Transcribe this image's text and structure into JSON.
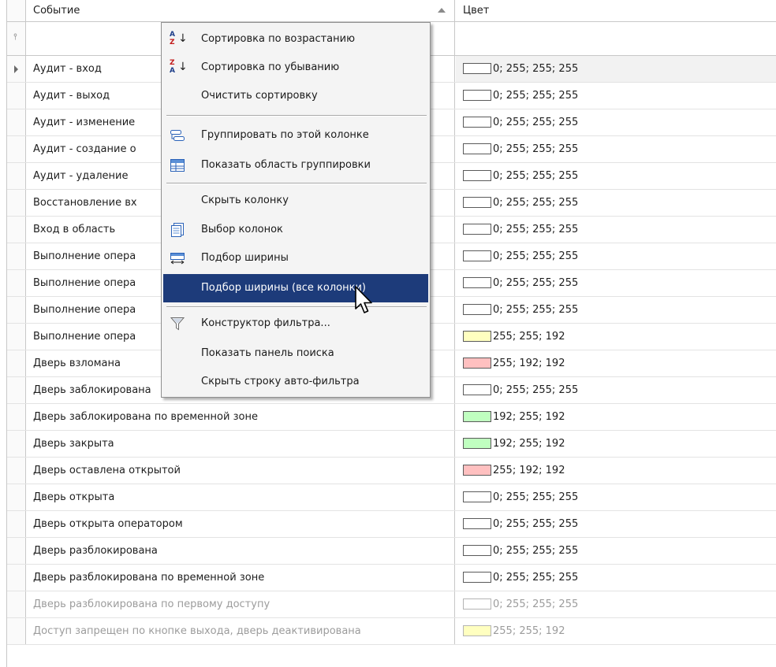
{
  "columns": {
    "event": "Событие",
    "color": "Цвет"
  },
  "rows": [
    {
      "event": "Аудит - вход",
      "color_text": "0; 255; 255; 255",
      "swatch": "#ffffff"
    },
    {
      "event": "Аудит - выход",
      "color_text": "0; 255; 255; 255",
      "swatch": "#ffffff"
    },
    {
      "event": "Аудит - изменение",
      "color_text": "0; 255; 255; 255",
      "swatch": "#ffffff"
    },
    {
      "event": "Аудит - создание о",
      "color_text": "0; 255; 255; 255",
      "swatch": "#ffffff"
    },
    {
      "event": "Аудит - удаление",
      "color_text": "0; 255; 255; 255",
      "swatch": "#ffffff"
    },
    {
      "event": "Восстановление вх",
      "color_text": "0; 255; 255; 255",
      "swatch": "#ffffff"
    },
    {
      "event": "Вход в область",
      "color_text": "0; 255; 255; 255",
      "swatch": "#ffffff"
    },
    {
      "event": "Выполнение опера",
      "color_text": "0; 255; 255; 255",
      "swatch": "#ffffff"
    },
    {
      "event": "Выполнение опера",
      "color_text": "0; 255; 255; 255",
      "swatch": "#ffffff"
    },
    {
      "event": "Выполнение опера",
      "color_text": "0; 255; 255; 255",
      "swatch": "#ffffff"
    },
    {
      "event": "Выполнение опера",
      "color_text": "255; 255; 192",
      "swatch": "#ffffc0"
    },
    {
      "event": "Дверь взломана",
      "color_text": "255; 192; 192",
      "swatch": "#ffc0c0"
    },
    {
      "event": "Дверь заблокирована",
      "color_text": "0; 255; 255; 255",
      "swatch": "#ffffff"
    },
    {
      "event": "Дверь заблокирована по временной зоне",
      "color_text": "192; 255; 192",
      "swatch": "#c0ffc0"
    },
    {
      "event": "Дверь закрыта",
      "color_text": "192; 255; 192",
      "swatch": "#c0ffc0"
    },
    {
      "event": "Дверь оставлена открытой",
      "color_text": "255; 192; 192",
      "swatch": "#ffc0c0"
    },
    {
      "event": "Дверь открыта",
      "color_text": "0; 255; 255; 255",
      "swatch": "#ffffff"
    },
    {
      "event": "Дверь открыта оператором",
      "color_text": "0; 255; 255; 255",
      "swatch": "#ffffff"
    },
    {
      "event": "Дверь разблокирована",
      "color_text": "0; 255; 255; 255",
      "swatch": "#ffffff"
    },
    {
      "event": "Дверь разблокирована по временной зоне",
      "color_text": "0; 255; 255; 255",
      "swatch": "#ffffff"
    },
    {
      "event": "Дверь разблокирована по первому доступу",
      "color_text": "0; 255; 255; 255",
      "swatch": "#ffffff"
    },
    {
      "event": "Доступ запрещен по кнопке выхода, дверь деактивирована",
      "color_text": "255; 255; 192",
      "swatch": "#ffffc0"
    }
  ],
  "menu": {
    "sort_asc": "Сортировка по возрастанию",
    "sort_desc": "Сортировка по убыванию",
    "clear_sort": "Очистить сортировку",
    "group_by": "Группировать по этой колонке",
    "show_group_area": "Показать область группировки",
    "hide_column": "Скрыть колонку",
    "column_chooser": "Выбор колонок",
    "best_fit": "Подбор ширины",
    "best_fit_all": "Подбор ширины (все колонки)",
    "filter_editor": "Конструктор фильтра...",
    "show_find_panel": "Показать панель поиска",
    "hide_auto_filter": "Скрыть строку авто-фильтра"
  },
  "colors": {
    "menu_highlight": "#1d3b7a",
    "grid_line": "#c8c8c8"
  }
}
